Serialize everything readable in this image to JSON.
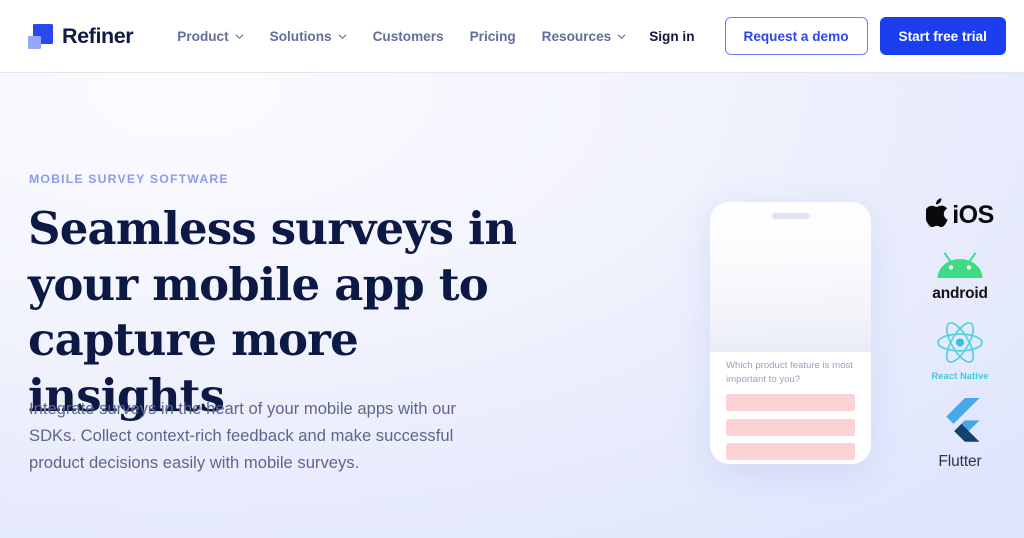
{
  "header": {
    "brand": {
      "name": "Refiner",
      "icon": "refiner-logo-icon"
    },
    "nav": [
      {
        "label": "Product",
        "has_chevron": true,
        "icon": "chevron-down-icon"
      },
      {
        "label": "Solutions",
        "has_chevron": true,
        "icon": "chevron-down-icon"
      },
      {
        "label": "Customers",
        "has_chevron": false
      },
      {
        "label": "Pricing",
        "has_chevron": false
      },
      {
        "label": "Resources",
        "has_chevron": true,
        "icon": "chevron-down-icon"
      }
    ],
    "sign_in": "Sign in",
    "request_demo": "Request a demo",
    "start_trial": "Start free trial"
  },
  "hero": {
    "eyebrow": "MOBILE SURVEY SOFTWARE",
    "headline": "Seamless surveys in your mobile app to capture more insights",
    "subcopy": "Integrate surveys in the heart of your mobile apps with our SDKs. Collect context-rich feedback and make successful product decisions easily with mobile surveys."
  },
  "phone": {
    "question": "Which product feature is most important to you?",
    "options": [
      "",
      "",
      ""
    ]
  },
  "platforms": [
    {
      "name": "iOS",
      "label": "iOS",
      "icon": "apple-logo-icon"
    },
    {
      "name": "Android",
      "label": "android",
      "icon": "android-robot-icon"
    },
    {
      "name": "React Native",
      "label": "React Native",
      "icon": "react-atom-icon"
    },
    {
      "name": "Flutter",
      "label": "Flutter",
      "icon": "flutter-logo-icon"
    }
  ],
  "colors": {
    "brand_blue": "#2c47ee",
    "cta_blue": "#1a3ef0",
    "headline_navy": "#0d1945",
    "eyebrow_periwinkle": "#8b9cef",
    "body_slate": "#5d678c",
    "nav_slate": "#616f9b",
    "option_pink": "#fbd2d6",
    "android_green": "#3ddc84",
    "react_cyan": "#53d2e4",
    "flutter_blue": "#47a8e8",
    "flutter_navy": "#12416b"
  }
}
